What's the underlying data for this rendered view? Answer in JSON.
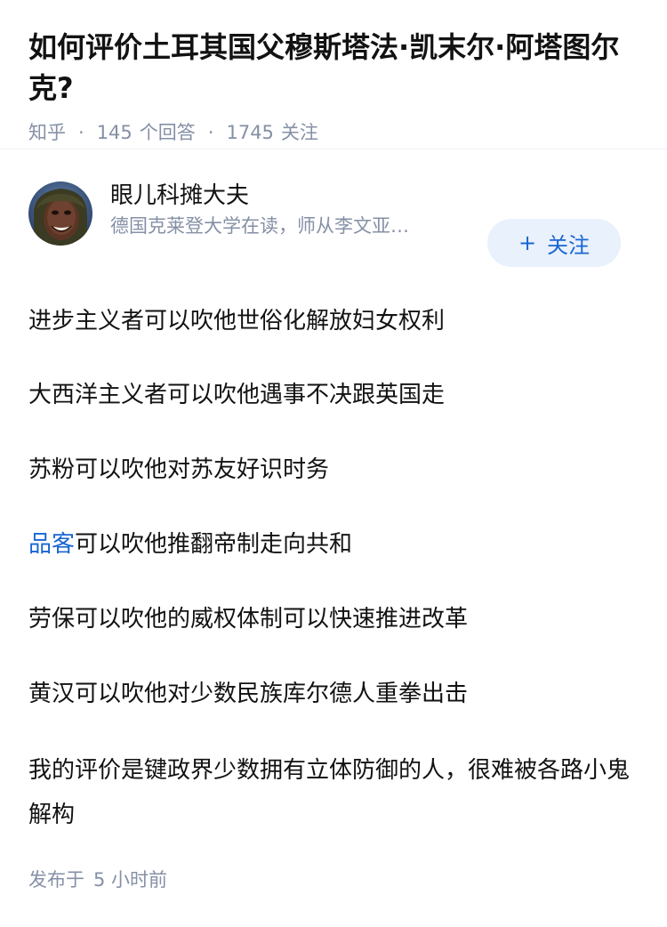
{
  "question": {
    "title": "如何评价土耳其国父穆斯塔法·凯末尔·阿塔图尔克?",
    "source": "知乎",
    "separator": "·",
    "answer_count": "145",
    "answer_label": "个回答",
    "follow_count": "1745",
    "follow_label": "关注"
  },
  "author": {
    "name": "眼儿科摊大夫",
    "bio": "德国克莱登大学在读，师从李文亚…",
    "follow_button_plus": "+",
    "follow_button_label": "关注"
  },
  "answer": {
    "paragraphs": [
      "进步主义者可以吹他世俗化解放妇女权利",
      "大西洋主义者可以吹他遇事不决跟英国走",
      "苏粉可以吹他对苏友好识时务",
      {
        "link": "品客",
        "rest": "可以吹他推翻帝制走向共和"
      },
      "劳保可以吹他的威权体制可以快速推进改革",
      "黄汉可以吹他对少数民族库尔德人重拳出击",
      "我的评价是键政界少数拥有立体防御的人，很难被各路小鬼解构"
    ],
    "published_label": "发布于",
    "published_time": "5 小时前"
  },
  "colors": {
    "accent": "#1966d2",
    "muted": "#8590a6",
    "follow_bg": "#e9f1fc",
    "text": "#121212"
  }
}
